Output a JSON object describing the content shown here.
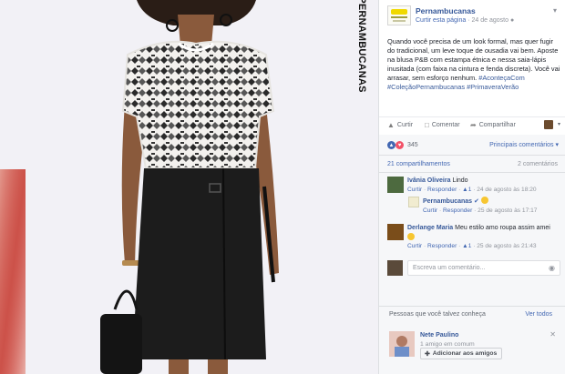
{
  "colors": {
    "fb_link": "#365899",
    "fb_blue": "#4267b2",
    "muted": "#90949c",
    "photo_bg": "#f2f1f6",
    "skirt": "#1c1c1c"
  },
  "photo": {
    "brand_vertical": "PERNAMBUCANAS"
  },
  "post": {
    "page_name": "Pernambucanas",
    "curtir_pagina": "Curtir esta página",
    "date_sep": " · ",
    "date": "24 de agosto",
    "globe_icon": "globe-icon",
    "text_plain": "Quando você precisa de um look formal, mas quer fugir do tradicional, um leve toque de ousadia vai bem. Aposte na blusa P&B com estampa étnica e nessa saia-lápis inusitada (com faixa na cintura e fenda discreta). Você vai arrasar, sem esforço nenhum. ",
    "hashtag1": "#AconteçaCom",
    "hashtag2": "#ColeçãoPernambucanas",
    "hashtag3": "#PrimaveraVerão",
    "actions": {
      "like": "Curtir",
      "comment": "Comentar",
      "share": "Compartilhar"
    },
    "reactions_count": "345",
    "top_comments": "Principais comentários ▾",
    "shares": "21 compartilhamentos",
    "comments_count": "2 comentários"
  },
  "comments": [
    {
      "name": "Ivânia Oliveira",
      "text": "Lindo",
      "like": "Curtir",
      "reply": "Responder",
      "likes": "1",
      "time": "24 de agosto às 18:20"
    },
    {
      "name": "Pernambucanas",
      "text": "",
      "like": "Curtir",
      "reply": "Responder",
      "time": "25 de agosto às 17:17"
    },
    {
      "name": "Derlange Maria",
      "text": "Meu estilo amo roupa assim amei",
      "like": "Curtir",
      "reply": "Responder",
      "likes": "1",
      "time": "25 de agosto às 21:43"
    }
  ],
  "write_comment_placeholder": "Escreva um comentário...",
  "pymk": {
    "title": "Pessoas que você talvez conheça",
    "see_all": "Ver todos",
    "name": "Nete Paulino",
    "mutual": "1 amigo em comum",
    "add_button": "Adicionar aos amigos"
  }
}
